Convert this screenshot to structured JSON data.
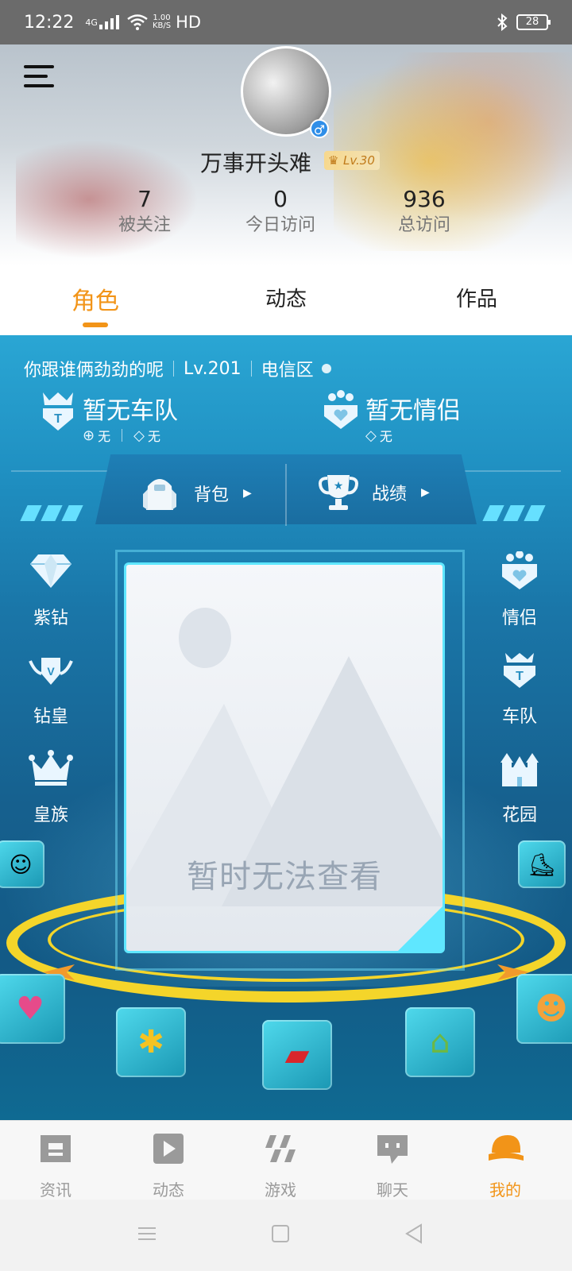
{
  "status_bar": {
    "time": "12:22",
    "network": "4G",
    "speed_value": "1.00",
    "speed_unit": "KB/S",
    "hd": "HD",
    "battery": "28"
  },
  "profile": {
    "username": "万事开头难",
    "level_badge": "Lv.30",
    "gender_symbol": "♂",
    "stats": [
      {
        "value": "7",
        "label": "被关注"
      },
      {
        "value": "0",
        "label": "今日访问"
      },
      {
        "value": "936",
        "label": "总访问"
      }
    ]
  },
  "tabs": [
    {
      "label": "角色",
      "active": true
    },
    {
      "label": "动态",
      "active": false
    },
    {
      "label": "作品",
      "active": false
    }
  ],
  "game": {
    "role_name": "你跟谁俩劲劲的呢",
    "role_level": "Lv.201",
    "server": "电信区",
    "team": {
      "title": "暂无车队",
      "stat1": "无",
      "stat2": "无"
    },
    "couple": {
      "title": "暂无情侣",
      "stat1": "无"
    },
    "bag_label": "背包",
    "record_label": "战绩",
    "left_items": [
      "紫钻",
      "钻皇",
      "皇族"
    ],
    "right_items": [
      "情侣",
      "车队",
      "花园"
    ],
    "card_message": "暂时无法查看"
  },
  "bottom_nav": [
    {
      "label": "资讯",
      "icon": "news-icon",
      "active": false
    },
    {
      "label": "动态",
      "icon": "play-icon",
      "active": false
    },
    {
      "label": "游戏",
      "icon": "game-icon",
      "active": false
    },
    {
      "label": "聊天",
      "icon": "chat-icon",
      "active": false
    },
    {
      "label": "我的",
      "icon": "cap-icon",
      "active": true
    }
  ],
  "colors": {
    "accent": "#f29418",
    "panel_blue": "#1a76a8",
    "cyan": "#5fe7ff"
  }
}
